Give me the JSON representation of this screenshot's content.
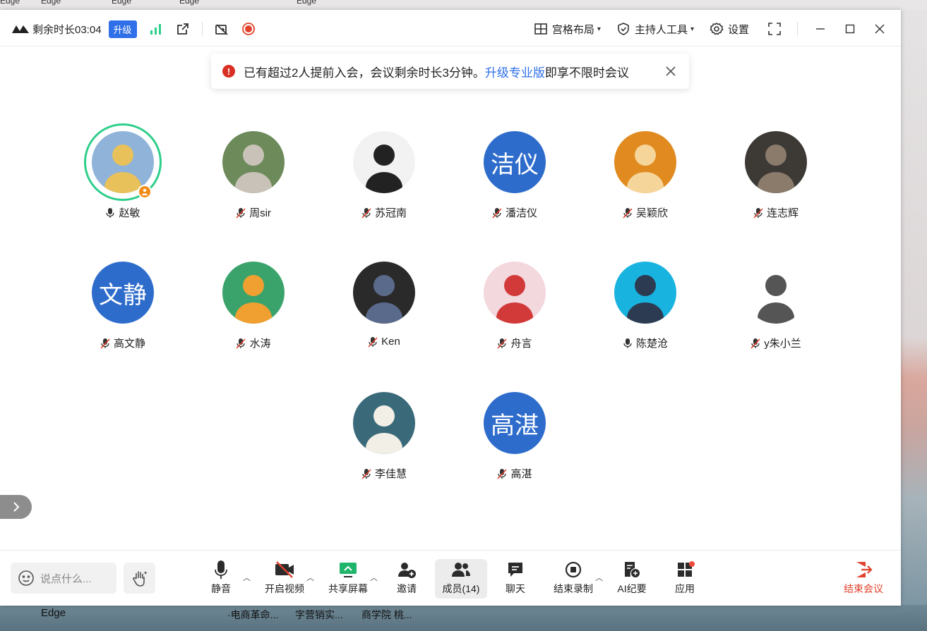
{
  "desktop": {
    "top_labels": [
      "Edge",
      "Edge",
      "Edge",
      "Edge",
      "Edge"
    ],
    "taskbar_items": [
      "Edge",
      "·电商革命...",
      "字营销实...",
      "商学院 桃..."
    ]
  },
  "titlebar": {
    "remaining_time": "剩余时长03:04",
    "upgrade_label": "升级",
    "grid_layout_label": "宫格布局",
    "host_tools_label": "主持人工具",
    "settings_label": "设置"
  },
  "notice": {
    "text_before": "已有超过2人提前入会，会议剩余时长3分钟。",
    "link_text": "升级专业版",
    "text_after": "即享不限时会议"
  },
  "participants": [
    {
      "name": "赵敏",
      "avatar_text": "",
      "muted": false,
      "speaking": true,
      "host": true
    },
    {
      "name": "周sir",
      "avatar_text": "",
      "muted": true
    },
    {
      "name": "苏冠南",
      "avatar_text": "",
      "muted": true
    },
    {
      "name": "潘洁仪",
      "avatar_text": "洁仪",
      "muted": true
    },
    {
      "name": "吴颖欣",
      "avatar_text": "",
      "muted": true
    },
    {
      "name": "连志辉",
      "avatar_text": "",
      "muted": true
    },
    {
      "name": "高文静",
      "avatar_text": "文静",
      "muted": true
    },
    {
      "name": "水涛",
      "avatar_text": "",
      "muted": true
    },
    {
      "name": "Ken",
      "avatar_text": "",
      "muted": true
    },
    {
      "name": "舟言",
      "avatar_text": "",
      "muted": true
    },
    {
      "name": "陈楚沧",
      "avatar_text": "",
      "muted": false
    },
    {
      "name": "y朱小兰",
      "avatar_text": "",
      "muted": true
    },
    {
      "name": "李佳慧",
      "avatar_text": "",
      "muted": true
    },
    {
      "name": "高湛",
      "avatar_text": "高湛",
      "muted": true
    }
  ],
  "bottombar": {
    "chat_placeholder": "说点什么...",
    "mute_label": "静音",
    "video_label": "开启视频",
    "share_label": "共享屏幕",
    "invite_label": "邀请",
    "members_label": "成员(14)",
    "chat_label": "聊天",
    "stop_record_label": "结束录制",
    "ai_minutes_label": "AI纪要",
    "apps_label": "应用",
    "end_meeting_label": "结束会议"
  },
  "colors": {
    "accent": "#2f6fe8",
    "avatar_blue": "#2e6ccc",
    "speaking_ring": "#2fcf8b",
    "host_badge": "#f28c15",
    "danger": "#e2412c"
  }
}
